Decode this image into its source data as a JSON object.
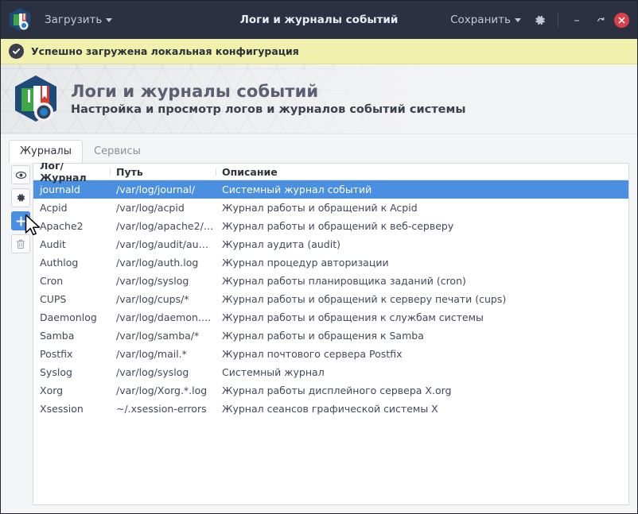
{
  "titlebar": {
    "app_icon": "books-gear-logo-icon",
    "load_menu_label": "Загрузить",
    "title": "Логи и журналы событий",
    "save_menu_label": "Сохранить",
    "settings_icon": "gear-icon",
    "minimize_label": "–",
    "maximize_label": "❐",
    "close_icon": "close-icon",
    "bg_color": "#2b3141"
  },
  "notification": {
    "icon": "check-circle-icon",
    "text": "Успешно загружена локальная конфигурация",
    "bg_color": "#f2f0ad"
  },
  "banner": {
    "logo_icon": "books-gear-logo-icon",
    "title": "Логи и журналы событий",
    "subtitle": "Настройка и просмотр логов и журналов событий системы"
  },
  "tabs": [
    {
      "label": "Журналы",
      "active": true
    },
    {
      "label": "Сервисы",
      "active": false
    }
  ],
  "side_toolbar": [
    {
      "name": "view-button",
      "icon": "eye-icon",
      "primary": false
    },
    {
      "name": "settings-button",
      "icon": "gear-icon",
      "primary": false
    },
    {
      "name": "add-button",
      "icon": "plus-icon",
      "primary": true
    },
    {
      "name": "delete-button",
      "icon": "trash-icon",
      "primary": false
    }
  ],
  "table": {
    "columns": [
      "Лог/Журнал",
      "Путь",
      "Описание"
    ],
    "accent_color": "#4a8fe0",
    "rows": [
      {
        "name": "journald",
        "path": "/var/log/journal/",
        "desc": "Системный журнал событий",
        "selected": true
      },
      {
        "name": "Acpid",
        "path": "/var/log/acpid",
        "desc": "Журнал работы и обращений к Acpid",
        "selected": false
      },
      {
        "name": "Apache2",
        "path": "/var/log/apache2/…",
        "desc": "Журнал работы и обращений к веб-серверу",
        "selected": false
      },
      {
        "name": "Audit",
        "path": "/var/log/audit/au…",
        "desc": "Журнал аудита (audit)",
        "selected": false
      },
      {
        "name": "Authlog",
        "path": "/var/log/auth.log",
        "desc": "Журнал процедур авторизации",
        "selected": false
      },
      {
        "name": "Cron",
        "path": "/var/log/syslog",
        "desc": "Журнал работы планировщика заданий (cron)",
        "selected": false
      },
      {
        "name": "CUPS",
        "path": "/var/log/cups/*",
        "desc": "Журнал работы и обращений к серверу печати (cups)",
        "selected": false
      },
      {
        "name": "Daemonlog",
        "path": "/var/log/daemon.…",
        "desc": "Журнал работы и обращения к службам системы",
        "selected": false
      },
      {
        "name": "Samba",
        "path": "/var/log/samba/*",
        "desc": "Журнал работы и обращения к Samba",
        "selected": false
      },
      {
        "name": "Postfix",
        "path": "/var/log/mail.*",
        "desc": "Журнал почтового сервера Postfix",
        "selected": false
      },
      {
        "name": "Syslog",
        "path": "/var/log/syslog",
        "desc": "Системный журнал",
        "selected": false
      },
      {
        "name": "Xorg",
        "path": "/var/log/Xorg.*.log",
        "desc": "Журнал работы дисплейного сервера X.org",
        "selected": false
      },
      {
        "name": "Xsession",
        "path": "~/.xsession-errors",
        "desc": "Журнал сеансов графической системы X",
        "selected": false
      }
    ]
  },
  "cursor": {
    "icon": "mouse-pointer-icon"
  }
}
